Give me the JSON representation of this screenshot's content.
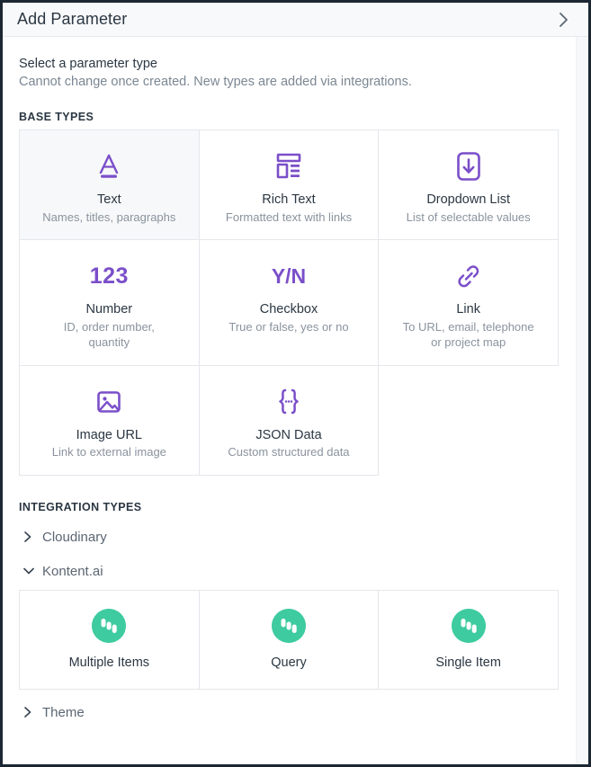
{
  "header": {
    "title": "Add Parameter",
    "collapse_icon": "chevron-right-icon"
  },
  "intro": {
    "title": "Select a parameter type",
    "subtitle": "Cannot change once created. New types are added via integrations."
  },
  "sections": {
    "base_types_label": "BASE TYPES",
    "integration_types_label": "INTEGRATION TYPES"
  },
  "colors": {
    "accent_purple": "#7b4fc9",
    "kontent_green": "#3ecba0",
    "selected_card_bg": "#f7f8f9",
    "border": "#e4e7eb",
    "title_text": "#2b3743",
    "muted_text": "#8a939e"
  },
  "base_types": [
    {
      "icon": "text-a-underline-icon",
      "title": "Text",
      "desc": "Names, titles, paragraphs",
      "selected": true
    },
    {
      "icon": "rich-text-layout-icon",
      "title": "Rich Text",
      "desc": "Formatted text with links",
      "selected": false
    },
    {
      "icon": "dropdown-arrow-box-icon",
      "title": "Dropdown List",
      "desc": "List of selectable values",
      "selected": false
    },
    {
      "icon": "number-123-icon",
      "title": "Number",
      "desc": "ID, order number, quantity",
      "selected": false
    },
    {
      "icon": "checkbox-yn-icon",
      "title": "Checkbox",
      "desc": "True or false, yes or no",
      "selected": false
    },
    {
      "icon": "link-chain-icon",
      "title": "Link",
      "desc": "To URL, email, telephone or project map",
      "selected": false
    },
    {
      "icon": "image-picture-icon",
      "title": "Image URL",
      "desc": "Link to external image",
      "selected": false
    },
    {
      "icon": "json-braces-icon",
      "title": "JSON Data",
      "desc": "Custom structured data",
      "selected": false
    }
  ],
  "integrations": [
    {
      "name": "Cloudinary",
      "expanded": false,
      "chevron": "chevron-right-icon",
      "items": []
    },
    {
      "name": "Kontent.ai",
      "expanded": true,
      "chevron": "chevron-down-icon",
      "items": [
        {
          "icon": "kontent-ai-logo-icon",
          "title": "Multiple Items"
        },
        {
          "icon": "kontent-ai-logo-icon",
          "title": "Query"
        },
        {
          "icon": "kontent-ai-logo-icon",
          "title": "Single Item"
        }
      ]
    },
    {
      "name": "Theme",
      "expanded": false,
      "chevron": "chevron-right-icon",
      "items": []
    }
  ]
}
